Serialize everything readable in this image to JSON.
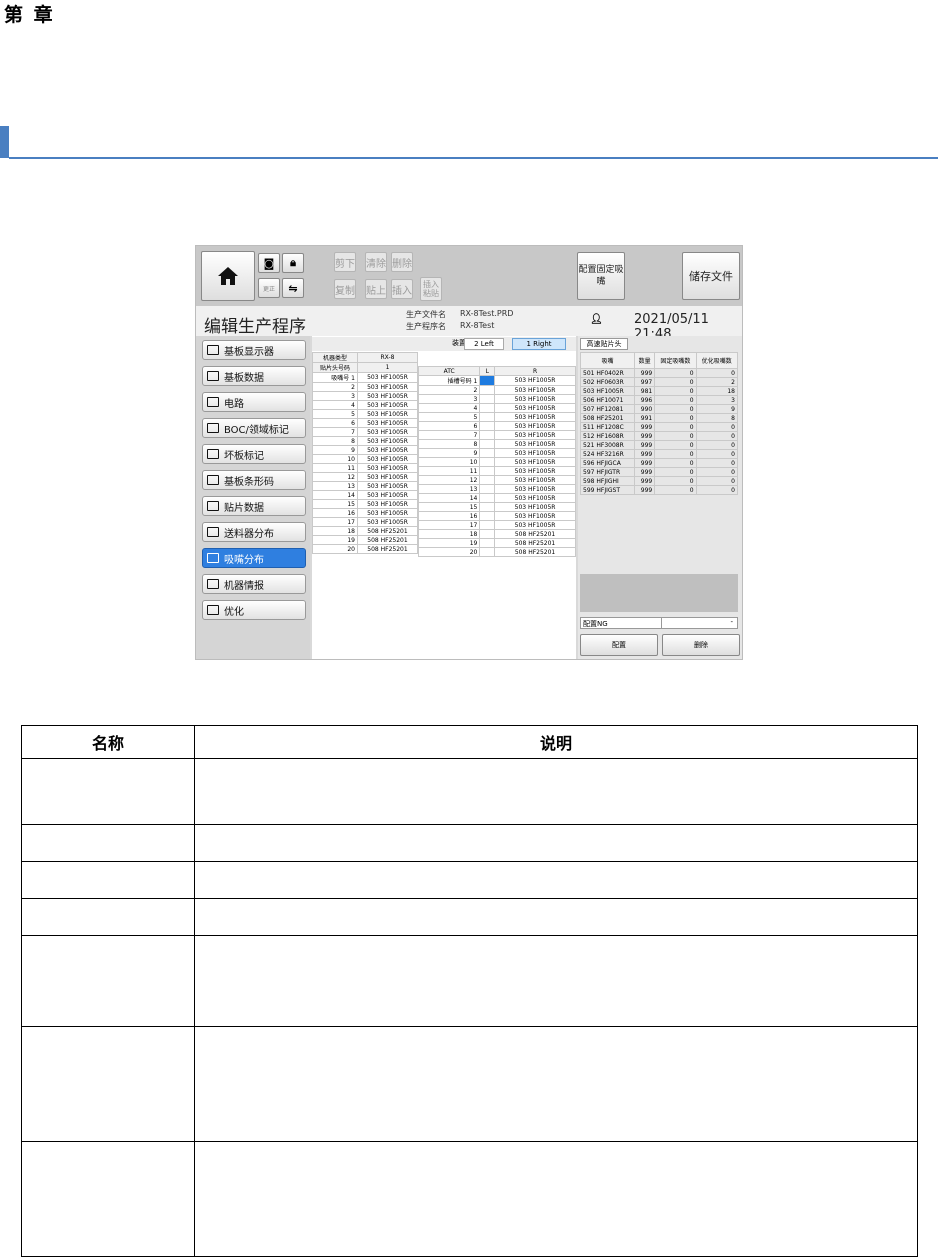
{
  "doc": {
    "chapter": "第  章",
    "desc_headers": [
      "名称",
      "说明"
    ],
    "desc_rows": [
      {
        "name": "",
        "text": ""
      },
      {
        "name": "",
        "text": ""
      },
      {
        "name": "",
        "text": ""
      },
      {
        "name": "",
        "text": ""
      },
      {
        "name": "",
        "text": ""
      },
      {
        "name": "",
        "text": ""
      },
      {
        "name": "",
        "text": ""
      }
    ]
  },
  "toolbar": {
    "cut": "剪下",
    "clear": "清除",
    "delete": "删除",
    "copy": "复制",
    "paste": "贴上",
    "insert": "插入",
    "insert_paste": "插入\n粘贴",
    "fixed_nozzle": "配置固定吸\n嘴",
    "save": "储存文件",
    "small_icon1_text": "更正",
    "home_icon": "home-icon"
  },
  "header": {
    "title": "编辑生产程序",
    "file_label": "生产文件名",
    "file_value": "RX-8Test.PRD",
    "prog_label": "生产程序名",
    "prog_value": "RX-8Test",
    "datetime": "2021/05/11 21:48"
  },
  "sidebar": {
    "items": [
      {
        "label": "基板显示器"
      },
      {
        "label": "基板数据"
      },
      {
        "label": "电路"
      },
      {
        "label": "BOC/领域标记"
      },
      {
        "label": "坏板标记"
      },
      {
        "label": "基板条形码"
      },
      {
        "label": "贴片数据"
      },
      {
        "label": "送料器分布"
      },
      {
        "label": "吸嘴分布"
      },
      {
        "label": "机器情报"
      },
      {
        "label": "优化"
      }
    ],
    "active_index": 8
  },
  "device": {
    "label": "装置",
    "left": "2 Left",
    "right": "1 Right"
  },
  "left_table": {
    "machine_type_label": "机器类型",
    "machine_type": "RX-8",
    "head_label": "贴片头号码",
    "head_col": "1",
    "nozzle_label": "吸嘴号",
    "rows": [
      [
        "1",
        "503 HF1005R"
      ],
      [
        "2",
        "503 HF1005R"
      ],
      [
        "3",
        "503 HF1005R"
      ],
      [
        "4",
        "503 HF1005R"
      ],
      [
        "5",
        "503 HF1005R"
      ],
      [
        "6",
        "503 HF1005R"
      ],
      [
        "7",
        "503 HF1005R"
      ],
      [
        "8",
        "503 HF1005R"
      ],
      [
        "9",
        "503 HF1005R"
      ],
      [
        "10",
        "503 HF1005R"
      ],
      [
        "11",
        "503 HF1005R"
      ],
      [
        "12",
        "503 HF1005R"
      ],
      [
        "13",
        "503 HF1005R"
      ],
      [
        "14",
        "503 HF1005R"
      ],
      [
        "15",
        "503 HF1005R"
      ],
      [
        "16",
        "503 HF1005R"
      ],
      [
        "17",
        "503 HF1005R"
      ],
      [
        "18",
        "508 HF25201"
      ],
      [
        "19",
        "508 HF25201"
      ],
      [
        "20",
        "508 HF25201"
      ]
    ]
  },
  "atc_table": {
    "headers": [
      "ATC",
      "L",
      "R"
    ],
    "slot_label": "插槽号码",
    "rows": [
      [
        "1",
        "",
        "503 HF1005R"
      ],
      [
        "2",
        "",
        "503 HF1005R"
      ],
      [
        "3",
        "",
        "503 HF1005R"
      ],
      [
        "4",
        "",
        "503 HF1005R"
      ],
      [
        "5",
        "",
        "503 HF1005R"
      ],
      [
        "6",
        "",
        "503 HF1005R"
      ],
      [
        "7",
        "",
        "503 HF1005R"
      ],
      [
        "8",
        "",
        "503 HF1005R"
      ],
      [
        "9",
        "",
        "503 HF1005R"
      ],
      [
        "10",
        "",
        "503 HF1005R"
      ],
      [
        "11",
        "",
        "503 HF1005R"
      ],
      [
        "12",
        "",
        "503 HF1005R"
      ],
      [
        "13",
        "",
        "503 HF1005R"
      ],
      [
        "14",
        "",
        "503 HF1005R"
      ],
      [
        "15",
        "",
        "503 HF1005R"
      ],
      [
        "16",
        "",
        "503 HF1005R"
      ],
      [
        "17",
        "",
        "503 HF1005R"
      ],
      [
        "18",
        "",
        "508 HF25201"
      ],
      [
        "19",
        "",
        "508 HF25201"
      ],
      [
        "20",
        "",
        "508 HF25201"
      ]
    ]
  },
  "right_panel": {
    "tab": "高速贴片头",
    "headers": [
      "吸嘴",
      "数量",
      "固定吸嘴数",
      "优化吸嘴数"
    ],
    "rows": [
      [
        "501 HF0402R",
        "999",
        "0",
        "0"
      ],
      [
        "502 HF0603R",
        "997",
        "0",
        "2"
      ],
      [
        "503 HF1005R",
        "981",
        "0",
        "18"
      ],
      [
        "506 HF10071",
        "996",
        "0",
        "3"
      ],
      [
        "507 HF12081",
        "990",
        "0",
        "9"
      ],
      [
        "508 HF25201",
        "991",
        "0",
        "8"
      ],
      [
        "511 HF1208C",
        "999",
        "0",
        "0"
      ],
      [
        "512 HF1608R",
        "999",
        "0",
        "0"
      ],
      [
        "521 HF3008R",
        "999",
        "0",
        "0"
      ],
      [
        "524 HF3216R",
        "999",
        "0",
        "0"
      ],
      [
        "596 HFJIGCA",
        "999",
        "0",
        "0"
      ],
      [
        "597 HFJIGTR",
        "999",
        "0",
        "0"
      ],
      [
        "598 HFJIGHI",
        "999",
        "0",
        "0"
      ],
      [
        "599 HFJIGST",
        "999",
        "0",
        "0"
      ]
    ],
    "ng_label": "配置NG",
    "ng_value": "-",
    "config_btn": "配置",
    "delete_btn": "删除"
  }
}
